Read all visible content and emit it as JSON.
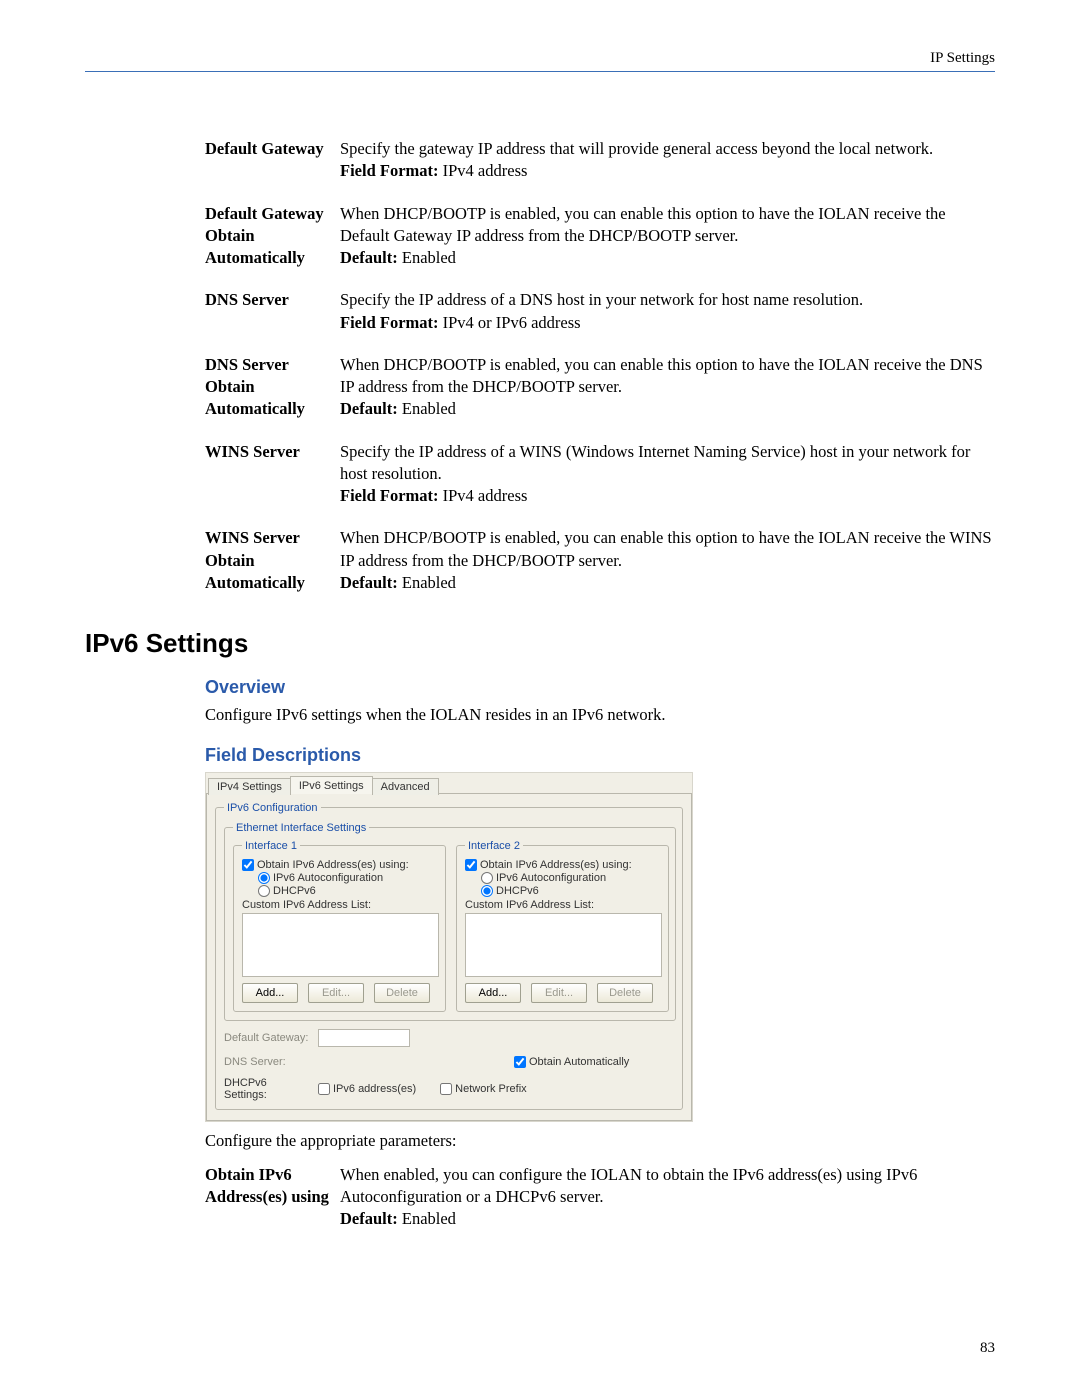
{
  "header": {
    "title": "IP Settings"
  },
  "page_number": "83",
  "fields_top": [
    {
      "label": "Default Gateway",
      "desc": "Specify the gateway IP address that will provide general access beyond the local network.",
      "extra_label": "Field Format:",
      "extra_value": "IPv4 address"
    },
    {
      "label": "Default Gateway Obtain Automatically",
      "desc": "When DHCP/BOOTP is enabled, you can enable this option to have the IOLAN receive the Default Gateway IP address from the DHCP/BOOTP server.",
      "extra_label": "Default:",
      "extra_value": "Enabled"
    },
    {
      "label": "DNS Server",
      "desc": "Specify the IP address of a DNS host in your network for host name resolution.",
      "extra_label": "Field Format:",
      "extra_value": "IPv4 or IPv6 address"
    },
    {
      "label": "DNS Server Obtain Automatically",
      "desc": "When DHCP/BOOTP is enabled, you can enable this option to have the IOLAN receive the DNS IP address from the DHCP/BOOTP server.",
      "extra_label": "Default:",
      "extra_value": "Enabled"
    },
    {
      "label": "WINS Server",
      "desc": "Specify the IP address of a WINS (Windows Internet Naming Service) host in your network for host resolution.",
      "extra_label": "Field Format:",
      "extra_value": "IPv4 address"
    },
    {
      "label": "WINS Server Obtain Automatically",
      "desc": "When DHCP/BOOTP is enabled, you can enable this option to have the IOLAN receive the WINS IP address from the DHCP/BOOTP server.",
      "extra_label": "Default:",
      "extra_value": "Enabled"
    }
  ],
  "section_title": "IPv6 Settings",
  "overview": {
    "heading": "Overview",
    "text": "Configure IPv6 settings when the IOLAN resides in an IPv6 network."
  },
  "field_desc_heading": "Field Descriptions",
  "dialog": {
    "tabs": [
      "IPv4 Settings",
      "IPv6 Settings",
      "Advanced"
    ],
    "active_tab": "IPv6 Settings",
    "group_title": "IPv6 Configuration",
    "eth_title": "Ethernet Interface Settings",
    "iface1": {
      "title": "Interface 1",
      "obtain": "Obtain IPv6 Address(es) using:",
      "autoconf": "IPv6 Autoconfiguration",
      "dhcp": "DHCPv6",
      "list_label": "Custom IPv6 Address List:",
      "add": "Add...",
      "edit": "Edit...",
      "delete": "Delete",
      "autoconf_checked": true,
      "dhcp_checked": false,
      "obtain_checked": true
    },
    "iface2": {
      "title": "Interface 2",
      "obtain": "Obtain IPv6 Address(es) using:",
      "autoconf": "IPv6 Autoconfiguration",
      "dhcp": "DHCPv6",
      "list_label": "Custom IPv6 Address List:",
      "add": "Add...",
      "edit": "Edit...",
      "delete": "Delete",
      "autoconf_checked": false,
      "dhcp_checked": true,
      "obtain_checked": true
    },
    "gw_label": "Default Gateway:",
    "dns_label": "DNS Server:",
    "dns_auto": "Obtain Automatically",
    "dhcp_settings": "DHCPv6 Settings:",
    "ipv6_addr": "IPv6 address(es)",
    "net_prefix": "Network Prefix"
  },
  "config_params": "Configure the appropriate parameters:",
  "fields_bottom": [
    {
      "label": "Obtain IPv6 Address(es) using",
      "desc": "When enabled, you can configure the IOLAN to obtain the IPv6 address(es) using IPv6 Autoconfiguration or a DHCPv6 server.",
      "extra_label": "Default:",
      "extra_value": "Enabled"
    }
  ]
}
